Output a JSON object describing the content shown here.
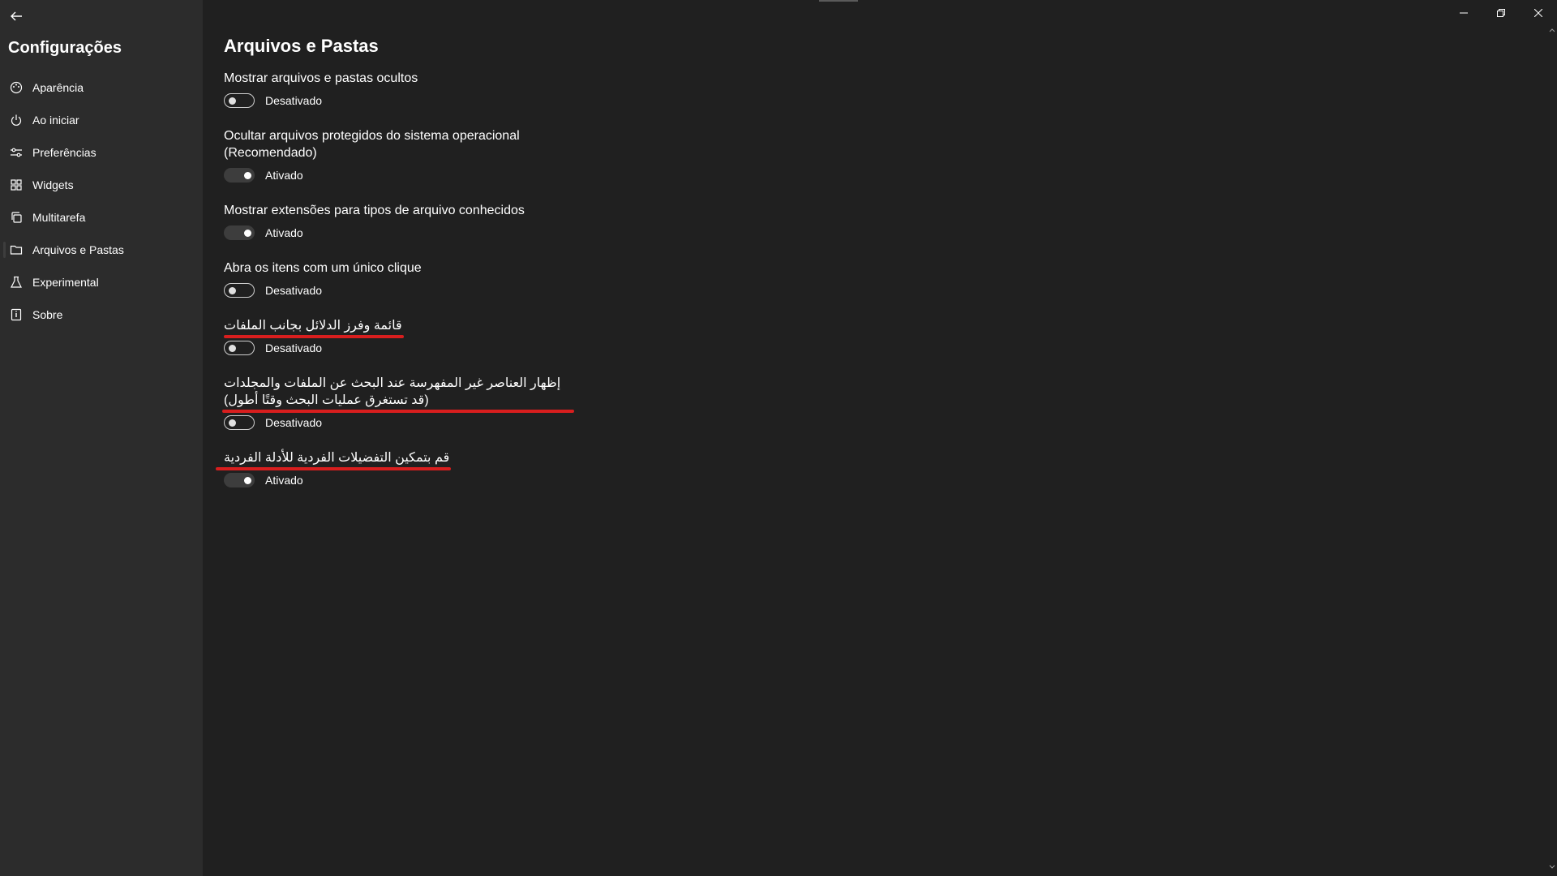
{
  "sidebar": {
    "title": "Configurações",
    "items": [
      {
        "label": "Aparência",
        "icon": "palette-icon"
      },
      {
        "label": "Ao iniciar",
        "icon": "power-icon"
      },
      {
        "label": "Preferências",
        "icon": "sliders-icon"
      },
      {
        "label": "Widgets",
        "icon": "widgets-icon"
      },
      {
        "label": "Multitarefa",
        "icon": "multitask-icon"
      },
      {
        "label": "Arquivos e Pastas",
        "icon": "folder-icon",
        "selected": true
      },
      {
        "label": "Experimental",
        "icon": "flask-icon"
      },
      {
        "label": "Sobre",
        "icon": "info-icon"
      }
    ]
  },
  "main": {
    "title": "Arquivos e Pastas",
    "settings": [
      {
        "label": "Mostrar arquivos e pastas ocultos",
        "state": "Desativado",
        "on": false
      },
      {
        "label": "Ocultar arquivos protegidos do sistema operacional (Recomendado)",
        "state": "Ativado",
        "on": true
      },
      {
        "label": "Mostrar extensões para tipos de arquivo conhecidos",
        "state": "Ativado",
        "on": true
      },
      {
        "label": "Abra os itens com um único clique",
        "state": "Desativado",
        "on": false
      },
      {
        "label": "قائمة وفرز الدلائل بجانب الملفات",
        "state": "Desativado",
        "on": false,
        "highlighted": true
      },
      {
        "label": "إظهار العناصر غير المفهرسة عند البحث عن الملفات والمجلدات (قد تستغرق عمليات البحث وقتًا أطول)",
        "state": "Desativado",
        "on": false,
        "highlighted": true
      },
      {
        "label": "قم بتمكين التفضيلات الفردية للأدلة الفردية",
        "state": "Ativado",
        "on": true,
        "highlighted": true
      }
    ]
  },
  "colors": {
    "background": "#202020",
    "sidebar": "#2c2c2c",
    "highlight_underline": "#d81e1e"
  }
}
